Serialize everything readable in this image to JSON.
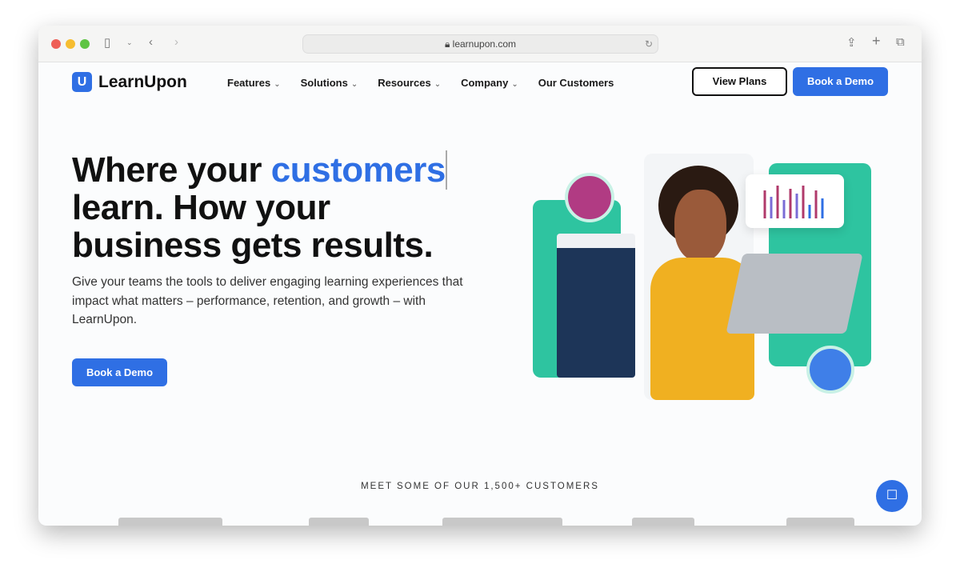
{
  "browser": {
    "url": "learnupon.com"
  },
  "nav": {
    "logo": "LearnUpon",
    "items": [
      {
        "label": "Features",
        "dropdown": true
      },
      {
        "label": "Solutions",
        "dropdown": true
      },
      {
        "label": "Resources",
        "dropdown": true
      },
      {
        "label": "Company",
        "dropdown": true
      },
      {
        "label": "Our Customers",
        "dropdown": false
      }
    ],
    "view_plans": "View Plans",
    "book_demo": "Book a Demo"
  },
  "hero": {
    "title_1": "Where your ",
    "title_accent": "customers",
    "title_2": "learn. How your",
    "title_3": "business gets results.",
    "subtitle": "Give your teams the tools to deliver engaging learning experiences that impact what matters – performance, retention, and growth – with LearnUpon.",
    "cta": "Book a Demo"
  },
  "customers": {
    "heading": "MEET SOME OF OUR 1,500+ CUSTOMERS"
  },
  "colors": {
    "accent": "#2f6fe4",
    "green": "#2ec4a0"
  }
}
